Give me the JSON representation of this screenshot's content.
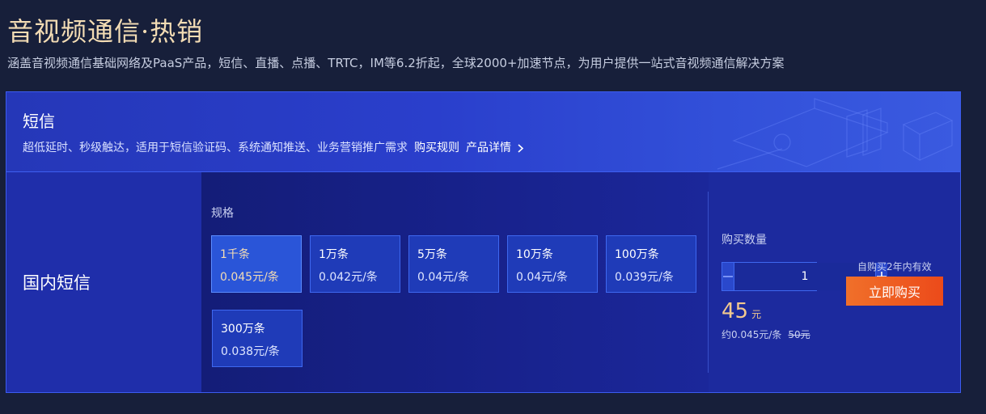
{
  "page": {
    "title": "音视频通信·热销",
    "subtitle": "涵盖音视频通信基础网络及PaaS产品，短信、直播、点播、TRTC，IM等6.2折起，全球2000+加速节点，为用户提供一站式音视频通信解决方案"
  },
  "product": {
    "name": "短信",
    "description": "超低延时、秒级触达，适用于短信验证码、系统通知推送、业务营销推广需求",
    "purchase_rules_link": "购买规则",
    "details_link": "产品详情"
  },
  "region": {
    "label": "国内短信"
  },
  "spec": {
    "label": "规格",
    "selected_index": 0,
    "options": [
      {
        "quantity": "1千条",
        "unit_price": "0.045元/条"
      },
      {
        "quantity": "1万条",
        "unit_price": "0.042元/条"
      },
      {
        "quantity": "5万条",
        "unit_price": "0.04元/条"
      },
      {
        "quantity": "10万条",
        "unit_price": "0.04元/条"
      },
      {
        "quantity": "100万条",
        "unit_price": "0.039元/条"
      },
      {
        "quantity": "300万条",
        "unit_price": "0.038元/条"
      }
    ]
  },
  "purchase": {
    "quantity_label": "购买数量",
    "quantity_value": "1",
    "price": "45",
    "price_unit": "元",
    "unit_price_note": "约0.045元/条",
    "original_price": "50元",
    "validity_note": "自购买2年内有效",
    "buy_button": "立即购买"
  },
  "icons": {
    "minus": "minus-icon",
    "plus": "plus-icon",
    "chevron": "chevron-right-icon"
  },
  "colors": {
    "background": "#171f3a",
    "title_gold": "#f3dcb4",
    "accent_blue": "#3e68f0",
    "buy_orange": "#ec4a1a"
  }
}
